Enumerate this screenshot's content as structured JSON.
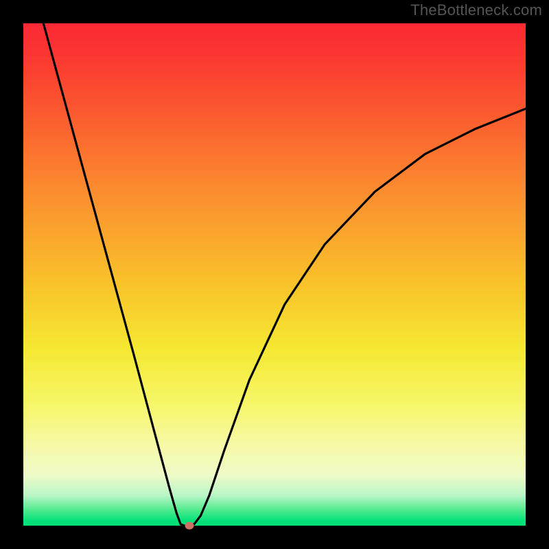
{
  "watermark": "TheBottleneck.com",
  "chart_data": {
    "type": "line",
    "title": "",
    "xlabel": "",
    "ylabel": "",
    "xlim": [
      0,
      1
    ],
    "ylim": [
      0,
      1
    ],
    "grid": false,
    "legend": false,
    "background": "red-yellow-green vertical gradient",
    "series": [
      {
        "name": "bottleneck-curve",
        "x": [
          0.04,
          0.1,
          0.16,
          0.22,
          0.26,
          0.29,
          0.305,
          0.313,
          0.32,
          0.33,
          0.34,
          0.353,
          0.37,
          0.4,
          0.45,
          0.52,
          0.6,
          0.7,
          0.8,
          0.9,
          1.0
        ],
        "y": [
          1.0,
          0.78,
          0.56,
          0.34,
          0.19,
          0.078,
          0.025,
          0.003,
          0.0,
          0.0,
          0.003,
          0.02,
          0.06,
          0.15,
          0.29,
          0.44,
          0.56,
          0.665,
          0.74,
          0.79,
          0.83
        ]
      }
    ],
    "marker": {
      "x": 0.33,
      "y": 0.0,
      "color": "#cf7064"
    },
    "colors": {
      "curve": "#000000",
      "frame": "#000000",
      "gradient_top": "#fb2a34",
      "gradient_mid": "#f9c32a",
      "gradient_bottom": "#03df77"
    }
  }
}
